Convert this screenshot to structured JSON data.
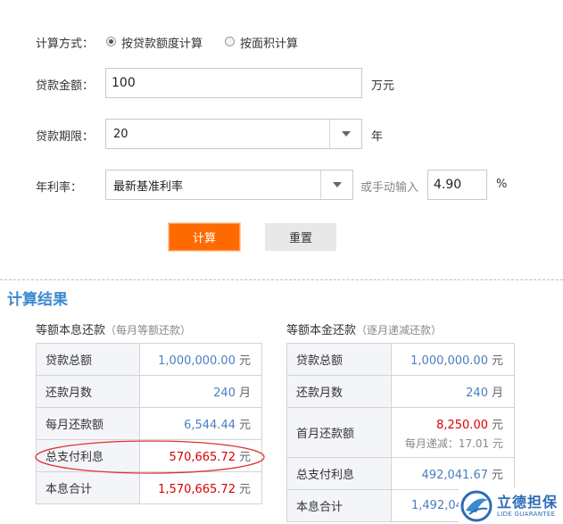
{
  "form": {
    "method_label": "计算方式：",
    "method_options": [
      "按贷款额度计算",
      "按面积计算"
    ],
    "amount_label": "贷款金额：",
    "amount_value": "100",
    "amount_unit": "万元",
    "term_label": "贷款期限：",
    "term_value": "20",
    "term_unit": "年",
    "rate_label": "年利率：",
    "rate_select": "最新基准利率",
    "rate_manual_hint": "或手动输入",
    "rate_value": "4.90",
    "rate_unit": "%",
    "calc_button": "计算",
    "reset_button": "重置"
  },
  "result": {
    "title": "计算结果",
    "left": {
      "heading": "等额本息还款",
      "sub": "（每月等额还款）",
      "rows": [
        {
          "key": "贷款总额",
          "value": "1,000,000.00",
          "unit": "元"
        },
        {
          "key": "还款月数",
          "value": "240",
          "unit": "月"
        },
        {
          "key": "每月还款额",
          "value": "6,544.44",
          "unit": "元"
        },
        {
          "key": "总支付利息",
          "value": "570,665.72",
          "unit": "元"
        },
        {
          "key": "本息合计",
          "value": "1,570,665.72",
          "unit": "元"
        }
      ]
    },
    "right": {
      "heading": "等额本金还款",
      "sub": "（逐月递减还款）",
      "rows": [
        {
          "key": "贷款总额",
          "value": "1,000,000.00",
          "unit": "元"
        },
        {
          "key": "还款月数",
          "value": "240",
          "unit": "月"
        },
        {
          "key": "首月还款额",
          "value": "8,250.00",
          "unit": "元",
          "note": "每月递减：17.01 元"
        },
        {
          "key": "总支付利息",
          "value": "492,041.67",
          "unit": "元"
        },
        {
          "key": "本息合计",
          "value": "1,492,04",
          "unit": ""
        }
      ]
    }
  },
  "watermark": {
    "brand_cn": "立德担保",
    "brand_en": "LIDE GUARANTEE"
  }
}
